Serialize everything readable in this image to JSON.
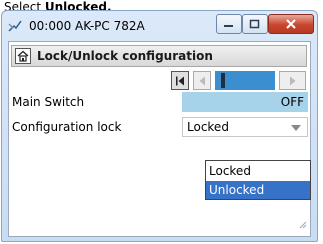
{
  "caption": {
    "prefix": "Select",
    "bold_word": "Unlocked."
  },
  "window": {
    "title": "00:000 AK-PC 782A"
  },
  "page": {
    "title": "Lock/Unlock configuration"
  },
  "parameters": [
    {
      "label": "Main Switch",
      "value": "OFF"
    },
    {
      "label": "Configuration lock",
      "value": "Locked"
    }
  ],
  "dropdown": {
    "options": [
      "Locked",
      "Unlocked"
    ],
    "highlighted": "Unlocked"
  },
  "colors": {
    "value_cell": "#a7d3ea",
    "nav_track": "#3b8ecf",
    "highlight": "#3672c8",
    "close_button": "#c9452f"
  }
}
